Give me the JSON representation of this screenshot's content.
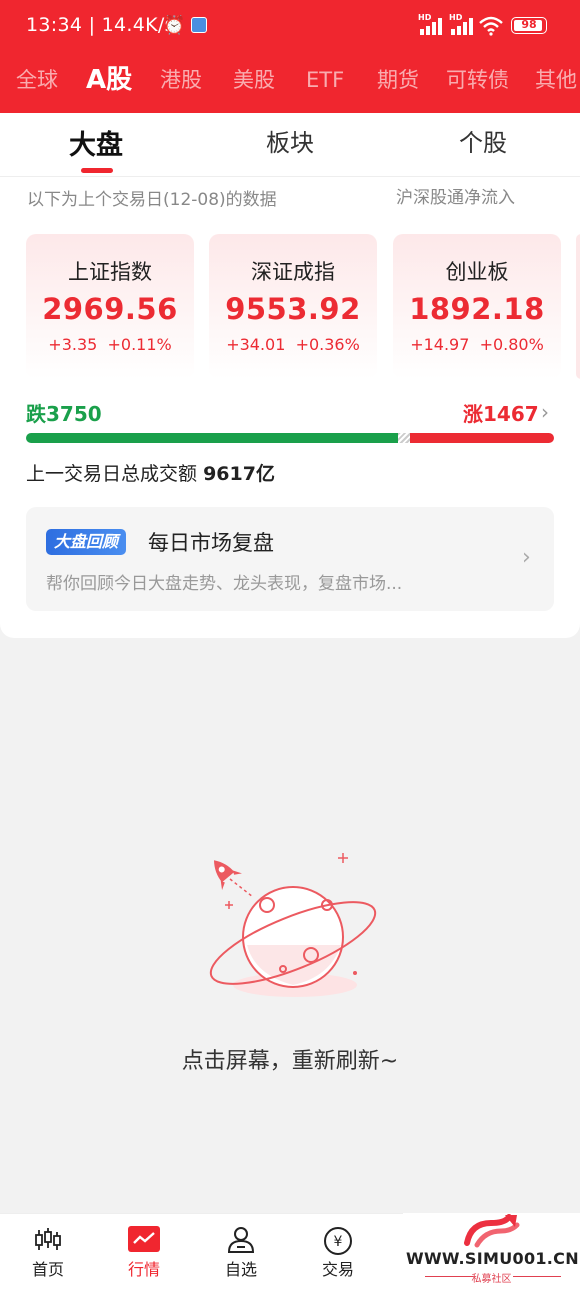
{
  "status_bar": {
    "time": "13:34",
    "separator": "|",
    "speed": "14.4K/s",
    "sim1": "HD",
    "sim2": "HD",
    "battery": "98"
  },
  "market_tabs": [
    "全球",
    "A股",
    "港股",
    "美股",
    "ETF",
    "期货",
    "可转债",
    "其他"
  ],
  "market_active": "A股",
  "sub_tabs": [
    "大盘",
    "板块",
    "个股"
  ],
  "sub_active": "大盘",
  "data_note": "以下为上个交易日(12-08)的数据",
  "northbound_label": "沪深股通净流入",
  "indices": [
    {
      "name": "上证指数",
      "value": "2969.56",
      "change": "+3.35",
      "percent": "+0.11%"
    },
    {
      "name": "深证成指",
      "value": "9553.92",
      "change": "+34.01",
      "percent": "+0.36%"
    },
    {
      "name": "创业板",
      "value": "1892.18",
      "change": "+14.97",
      "percent": "+0.80%"
    }
  ],
  "breadth": {
    "fall_label": "跌",
    "fall_count": "3750",
    "rise_label": "涨",
    "rise_count": "1467",
    "fall_ratio": 0.72,
    "rise_ratio": 0.28
  },
  "turnover": {
    "label": "上一交易日总成交额",
    "value": "9617亿"
  },
  "review": {
    "tag": "大盘回顾",
    "title": "每日市场复盘",
    "desc": "帮你回顾今日大盘走势、龙头表现，复盘市场..."
  },
  "empty_state": {
    "message": "点击屏幕，重新刷新~"
  },
  "bottom_nav": [
    {
      "label": "首页",
      "icon": "candlestick-icon"
    },
    {
      "label": "行情",
      "icon": "market-chart-icon"
    },
    {
      "label": "自选",
      "icon": "user-watchlist-icon"
    },
    {
      "label": "交易",
      "icon": "yuan-coin-icon"
    }
  ],
  "bottom_active": "行情",
  "watermark": {
    "url": "WWW.SIMU001.CN",
    "sub": "私募社区"
  },
  "colors": {
    "brand_red": "#f0262f",
    "up_red": "#ec2b33",
    "down_green": "#1aa04b"
  }
}
